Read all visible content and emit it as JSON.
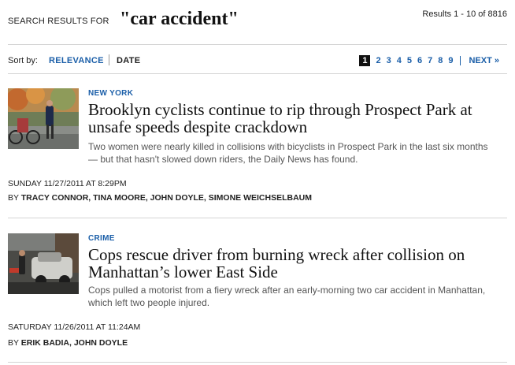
{
  "header": {
    "search_label": "SEARCH RESULTS FOR",
    "query": "\"car accident\"",
    "results_count": "Results 1 - 10 of 8816"
  },
  "sort": {
    "label": "Sort by:",
    "relevance": "RELEVANCE",
    "date": "DATE"
  },
  "pagination": {
    "pages": [
      "1",
      "2",
      "3",
      "4",
      "5",
      "6",
      "7",
      "8",
      "9"
    ],
    "current": "1",
    "next": "NEXT »"
  },
  "articles": [
    {
      "category": "NEW YORK",
      "headline": "Brooklyn cyclists continue to rip through Prospect Park at unsafe speeds despite crackdown",
      "summary": "Two women were nearly killed in collisions with bicyclists in Prospect Park in the last six months — but that hasn't slowed down riders, the Daily News has found.",
      "timestamp": "SUNDAY 11/27/2011 AT 8:29PM",
      "by_label": "BY",
      "authors": "TRACY CONNOR, TINA MOORE, JOHN DOYLE, SIMONE WEICHSELBAUM"
    },
    {
      "category": "CRIME",
      "headline": "Cops rescue driver from burning wreck after collision on Manhattan’s lower East Side",
      "summary": "Cops pulled a motorist from a fiery wreck after an early-morning two car accident in Manhattan, which left two people injured.",
      "timestamp": "SATURDAY 11/26/2011 AT 11:24AM",
      "by_label": "BY",
      "authors": "ERIK BADIA, JOHN DOYLE"
    }
  ],
  "colors": {
    "link_blue": "#1a5ea8",
    "headline": "#111111",
    "summary": "#555555",
    "rule": "#d4d4d4"
  }
}
